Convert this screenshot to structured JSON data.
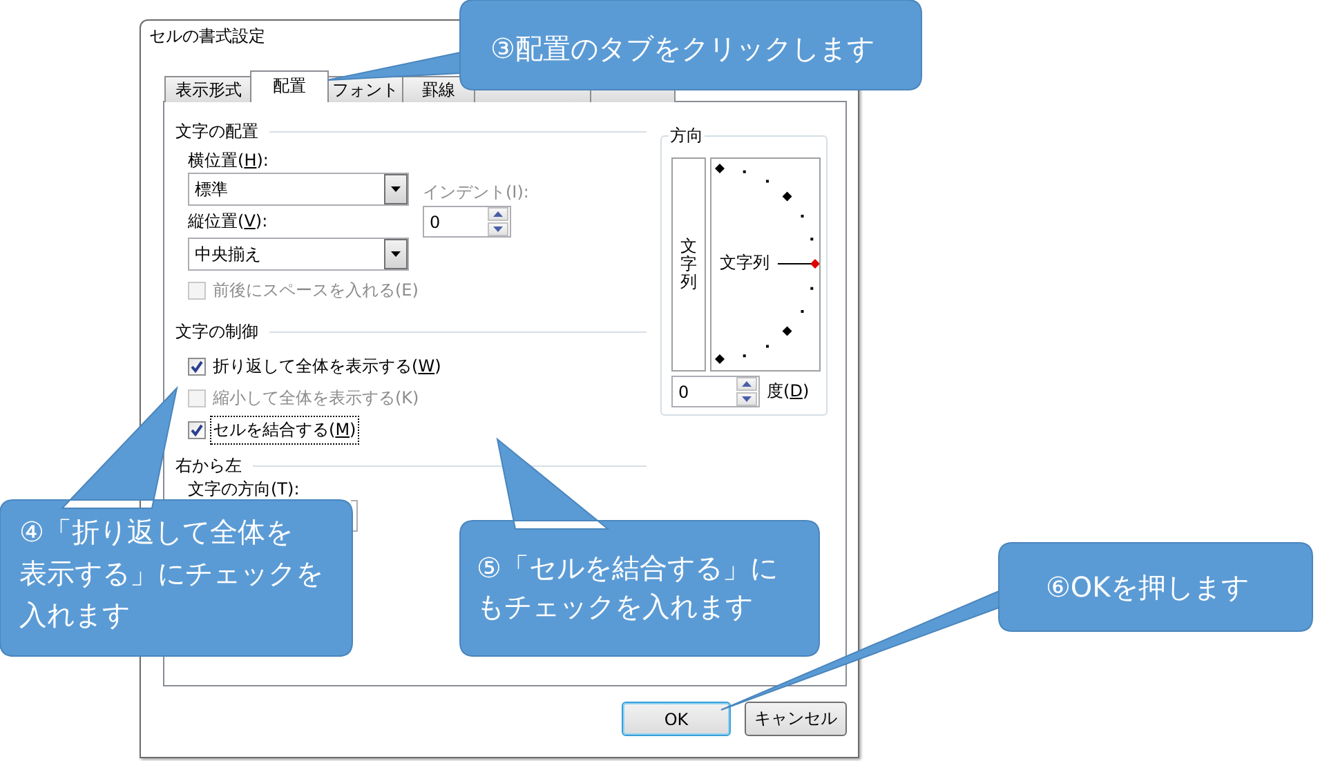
{
  "window": {
    "title": "セルの書式設定"
  },
  "tabs": [
    {
      "label": "表示形式",
      "selected": false
    },
    {
      "label": "配置",
      "selected": true
    },
    {
      "label": "フォント",
      "selected": false
    },
    {
      "label": "罫線",
      "selected": false
    },
    {
      "selected": false
    },
    {
      "selected": false
    }
  ],
  "text_alignment": {
    "heading": "文字の配置",
    "horizontal": {
      "label": "横位置(H):",
      "value": "標準",
      "mnemonic": true
    },
    "indent": {
      "label": "インデント(I):",
      "value": "0",
      "disabled": true
    },
    "vertical": {
      "label": "縦位置(V):",
      "value": "中央揃え",
      "mnemonic": true
    },
    "distributed": {
      "label": "前後にスペースを入れる(E)",
      "checked": false,
      "disabled": true
    }
  },
  "text_control": {
    "heading": "文字の制御",
    "options": [
      {
        "label": "折り返して全体を表示する(W)",
        "checked": true,
        "disabled": false,
        "focused": false,
        "mnemonic": true
      },
      {
        "label": "縮小して全体を表示する(K)",
        "checked": false,
        "disabled": true,
        "focused": false,
        "mnemonic": false
      },
      {
        "label": "セルを結合する(M)",
        "checked": true,
        "disabled": false,
        "focused": true,
        "mnemonic": true
      }
    ]
  },
  "right_to_left": {
    "heading": "右から左",
    "direction_label": "文字の方向(T):"
  },
  "orientation": {
    "heading": "方向",
    "vertical_text": "文字列",
    "dial_text": "文字列",
    "degrees": {
      "value": "0",
      "label": "度(D)",
      "mnemonic": true
    }
  },
  "buttons": [
    {
      "label": "OK",
      "default": true
    },
    {
      "label": "キャンセル",
      "default": false
    }
  ],
  "callouts": [
    {
      "lines": [
        "③配置のタブをクリックします"
      ]
    },
    {
      "lines": [
        "④「折り返して全体を",
        "表示する」にチェックを",
        "入れます"
      ]
    },
    {
      "lines": [
        "⑤「セルを結合する」に",
        "もチェックを入れます"
      ]
    },
    {
      "lines": [
        "⑥OKを押します"
      ]
    }
  ]
}
